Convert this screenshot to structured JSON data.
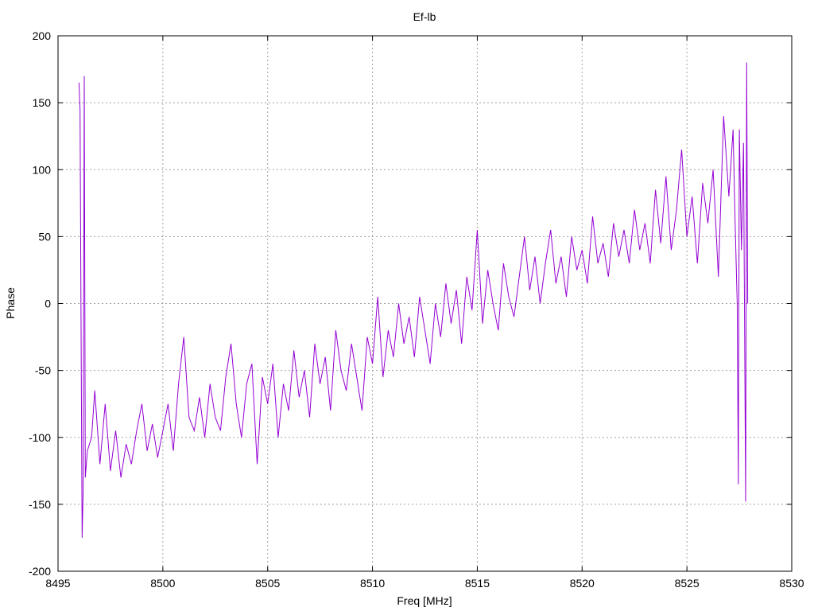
{
  "chart_data": {
    "type": "line",
    "title": "Ef-lb",
    "xlabel": "Freq [MHz]",
    "ylabel": "Phase",
    "xlim": [
      8495,
      8530
    ],
    "ylim": [
      -200,
      200
    ],
    "xticks": [
      8495,
      8500,
      8505,
      8510,
      8515,
      8520,
      8525,
      8530
    ],
    "yticks": [
      -200,
      -150,
      -100,
      -50,
      0,
      50,
      100,
      150,
      200
    ],
    "grid": true,
    "legend": "none",
    "series": [
      {
        "name": "Phase",
        "color": "#9400d3",
        "points": [
          [
            8496.0,
            165
          ],
          [
            8496.05,
            145
          ],
          [
            8496.1,
            -20
          ],
          [
            8496.15,
            -175
          ],
          [
            8496.2,
            -140
          ],
          [
            8496.25,
            170
          ],
          [
            8496.3,
            -130
          ],
          [
            8496.4,
            -110
          ],
          [
            8496.6,
            -100
          ],
          [
            8496.75,
            -65
          ],
          [
            8497.0,
            -120
          ],
          [
            8497.25,
            -75
          ],
          [
            8497.5,
            -125
          ],
          [
            8497.75,
            -95
          ],
          [
            8498.0,
            -130
          ],
          [
            8498.25,
            -105
          ],
          [
            8498.5,
            -120
          ],
          [
            8498.75,
            -95
          ],
          [
            8499.0,
            -75
          ],
          [
            8499.25,
            -110
          ],
          [
            8499.5,
            -90
          ],
          [
            8499.75,
            -115
          ],
          [
            8500.0,
            -95
          ],
          [
            8500.25,
            -75
          ],
          [
            8500.5,
            -110
          ],
          [
            8500.75,
            -60
          ],
          [
            8501.0,
            -25
          ],
          [
            8501.25,
            -85
          ],
          [
            8501.5,
            -95
          ],
          [
            8501.75,
            -70
          ],
          [
            8502.0,
            -100
          ],
          [
            8502.25,
            -60
          ],
          [
            8502.5,
            -85
          ],
          [
            8502.75,
            -95
          ],
          [
            8503.0,
            -55
          ],
          [
            8503.25,
            -30
          ],
          [
            8503.5,
            -75
          ],
          [
            8503.75,
            -100
          ],
          [
            8504.0,
            -60
          ],
          [
            8504.25,
            -45
          ],
          [
            8504.5,
            -120
          ],
          [
            8504.75,
            -55
          ],
          [
            8505.0,
            -75
          ],
          [
            8505.25,
            -45
          ],
          [
            8505.5,
            -100
          ],
          [
            8505.75,
            -60
          ],
          [
            8506.0,
            -80
          ],
          [
            8506.25,
            -35
          ],
          [
            8506.5,
            -70
          ],
          [
            8506.75,
            -50
          ],
          [
            8507.0,
            -85
          ],
          [
            8507.25,
            -30
          ],
          [
            8507.5,
            -60
          ],
          [
            8507.75,
            -40
          ],
          [
            8508.0,
            -80
          ],
          [
            8508.25,
            -20
          ],
          [
            8508.5,
            -50
          ],
          [
            8508.75,
            -65
          ],
          [
            8509.0,
            -30
          ],
          [
            8509.25,
            -55
          ],
          [
            8509.5,
            -80
          ],
          [
            8509.75,
            -25
          ],
          [
            8510.0,
            -45
          ],
          [
            8510.25,
            5
          ],
          [
            8510.5,
            -55
          ],
          [
            8510.75,
            -20
          ],
          [
            8511.0,
            -40
          ],
          [
            8511.25,
            0
          ],
          [
            8511.5,
            -30
          ],
          [
            8511.75,
            -10
          ],
          [
            8512.0,
            -40
          ],
          [
            8512.25,
            5
          ],
          [
            8512.5,
            -20
          ],
          [
            8512.75,
            -45
          ],
          [
            8513.0,
            0
          ],
          [
            8513.25,
            -25
          ],
          [
            8513.5,
            15
          ],
          [
            8513.75,
            -15
          ],
          [
            8514.0,
            10
          ],
          [
            8514.25,
            -30
          ],
          [
            8514.5,
            20
          ],
          [
            8514.75,
            -5
          ],
          [
            8515.0,
            55
          ],
          [
            8515.25,
            -15
          ],
          [
            8515.5,
            25
          ],
          [
            8515.75,
            0
          ],
          [
            8516.0,
            -20
          ],
          [
            8516.25,
            30
          ],
          [
            8516.5,
            5
          ],
          [
            8516.75,
            -10
          ],
          [
            8517.0,
            20
          ],
          [
            8517.25,
            50
          ],
          [
            8517.5,
            10
          ],
          [
            8517.75,
            35
          ],
          [
            8518.0,
            0
          ],
          [
            8518.25,
            30
          ],
          [
            8518.5,
            55
          ],
          [
            8518.75,
            15
          ],
          [
            8519.0,
            35
          ],
          [
            8519.25,
            5
          ],
          [
            8519.5,
            50
          ],
          [
            8519.75,
            25
          ],
          [
            8520.0,
            40
          ],
          [
            8520.25,
            15
          ],
          [
            8520.5,
            65
          ],
          [
            8520.75,
            30
          ],
          [
            8521.0,
            45
          ],
          [
            8521.25,
            20
          ],
          [
            8521.5,
            60
          ],
          [
            8521.75,
            35
          ],
          [
            8522.0,
            55
          ],
          [
            8522.25,
            30
          ],
          [
            8522.5,
            70
          ],
          [
            8522.75,
            40
          ],
          [
            8523.0,
            60
          ],
          [
            8523.25,
            30
          ],
          [
            8523.5,
            85
          ],
          [
            8523.75,
            45
          ],
          [
            8524.0,
            95
          ],
          [
            8524.25,
            40
          ],
          [
            8524.5,
            70
          ],
          [
            8524.75,
            115
          ],
          [
            8525.0,
            50
          ],
          [
            8525.25,
            80
          ],
          [
            8525.5,
            30
          ],
          [
            8525.75,
            90
          ],
          [
            8526.0,
            60
          ],
          [
            8526.25,
            100
          ],
          [
            8526.5,
            20
          ],
          [
            8526.75,
            140
          ],
          [
            8527.0,
            80
          ],
          [
            8527.2,
            130
          ],
          [
            8527.3,
            60
          ],
          [
            8527.4,
            0
          ],
          [
            8527.45,
            -135
          ],
          [
            8527.5,
            130
          ],
          [
            8527.6,
            40
          ],
          [
            8527.7,
            120
          ],
          [
            8527.8,
            -148
          ],
          [
            8527.85,
            180
          ],
          [
            8527.9,
            0
          ]
        ]
      }
    ]
  }
}
